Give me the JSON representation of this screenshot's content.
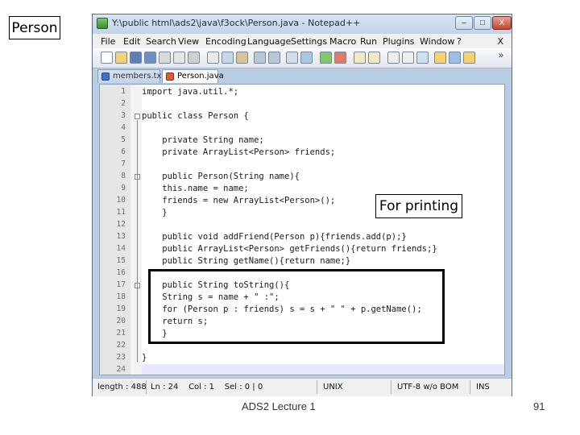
{
  "annotations": {
    "top_left_label": "Person",
    "printing_label": "For printing"
  },
  "window": {
    "title": "Y:\\public html\\ads2\\java\\f3ock\\Person.java - Notepad++",
    "buttons": {
      "minimize": "–",
      "maximize": "□",
      "close": "X"
    },
    "app_icon": "notepad-plus-plus-icon"
  },
  "menu": {
    "items": [
      "File",
      "Edit",
      "Search",
      "View",
      "Encoding",
      "Language",
      "Settings",
      "Macro",
      "Run",
      "Plugins",
      "Window",
      "?"
    ],
    "close_glyph": "X"
  },
  "toolbar": {
    "overflow_glyph": "»"
  },
  "tabs": [
    {
      "label": "members.txt",
      "icon": "blue-file-icon"
    },
    {
      "label": "Person.java",
      "icon": "red-file-icon",
      "active": true
    }
  ],
  "editor": {
    "lines": [
      "import java.util.*;",
      "",
      "public class Person {",
      "",
      "    private String name;",
      "    private ArrayList<Person> friends;",
      "",
      "    public Person(String name){",
      "    this.name = name;",
      "    friends = new ArrayList<Person>();",
      "    }",
      "",
      "    public void addFriend(Person p){friends.add(p);}",
      "    public ArrayList<Person> getFriends(){return friends;}",
      "    public String getName(){return name;}",
      "",
      "    public String toString(){",
      "    String s = name + \" :\";",
      "    for (Person p : friends) s = s + \" \" + p.getName();",
      "    return s;",
      "    }",
      "",
      "}",
      ""
    ],
    "current_line": 24,
    "fold_lines": [
      3,
      8,
      17
    ]
  },
  "statusbar": {
    "length": "length : 488",
    "position": "Ln : 24    Col : 1    Sel : 0 | 0",
    "eol": "UNIX",
    "encoding": "UTF-8 w/o BOM",
    "mode": "INS"
  },
  "footer": {
    "center": "ADS2 Lecture 1",
    "page": "91"
  },
  "colors": {
    "window_frame": "#b9cde3",
    "gutter": "#e6e6e6",
    "current_line": "#e8e8ff"
  }
}
